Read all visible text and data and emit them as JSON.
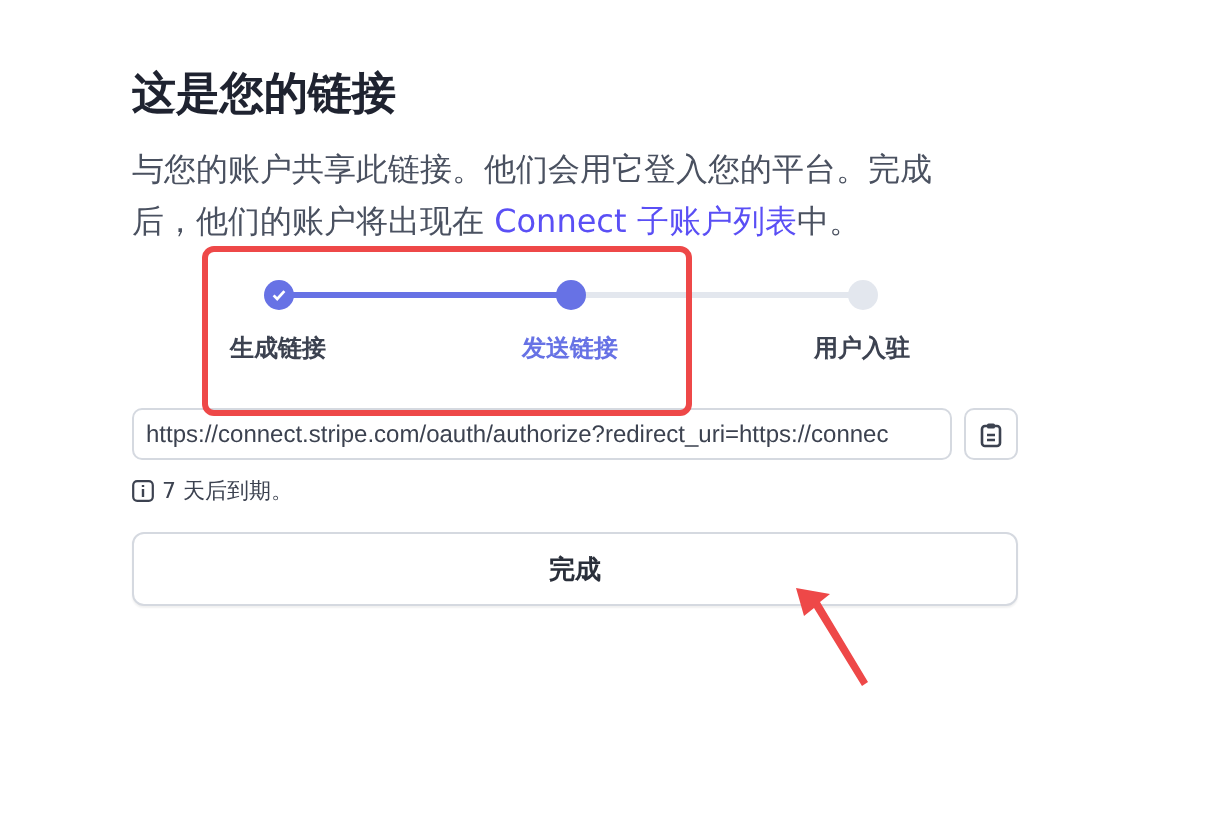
{
  "title": "这是您的链接",
  "description": {
    "text": "与您的账户共享此链接。他们会用它登入您的平台。完成后，他们的账户将出现在 ",
    "link": "Connect 子账户列表",
    "suffix": "中。"
  },
  "steps": [
    {
      "label": "生成链接",
      "done": true,
      "selected": false
    },
    {
      "label": "发送链接",
      "done": false,
      "selected": true
    },
    {
      "label": "用户入驻",
      "done": false,
      "selected": false
    }
  ],
  "link_field": {
    "value": "https://connect.stripe.com/oauth/authorize?redirect_uri=https://connec"
  },
  "expiry_note": "7 天后到期。",
  "done_button": "完成"
}
